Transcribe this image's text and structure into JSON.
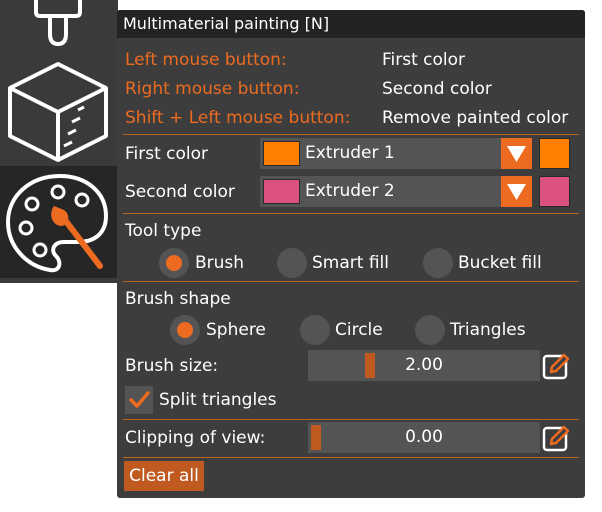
{
  "panel": {
    "title": "Multimaterial painting [N]",
    "mouse_rows": [
      {
        "label": "Left mouse button:",
        "value": "First color"
      },
      {
        "label": "Right mouse button:",
        "value": "Second color"
      },
      {
        "label": "Shift + Left mouse button:",
        "value": "Remove painted color"
      }
    ],
    "first_color": {
      "label": "First color",
      "selected": "Extruder 1",
      "color": "#FF8000"
    },
    "second_color": {
      "label": "Second color",
      "selected": "Extruder 2",
      "color": "#DB5182"
    },
    "tool_type": {
      "label": "Tool type",
      "options": [
        "Brush",
        "Smart fill",
        "Bucket fill"
      ],
      "selected": "Brush"
    },
    "brush_shape": {
      "label": "Brush shape",
      "options": [
        "Sphere",
        "Circle",
        "Triangles"
      ],
      "selected": "Sphere"
    },
    "brush_size": {
      "label": "Brush size:",
      "value": "2.00",
      "position": 0.25
    },
    "split_triangles": {
      "label": "Split triangles",
      "checked": true
    },
    "clipping": {
      "label": "Clipping of view:",
      "value": "0.00",
      "position": 0.0
    },
    "clear_all_label": "Clear all"
  },
  "toolbar": {
    "tools": [
      "support-tool-icon",
      "seam-cube-icon",
      "multimaterial-palette-icon"
    ],
    "active": "multimaterial-palette-icon"
  },
  "colors": {
    "accent": "#ED6B21",
    "panel_bg": "#3D3D3D",
    "title_bg": "#232323"
  }
}
